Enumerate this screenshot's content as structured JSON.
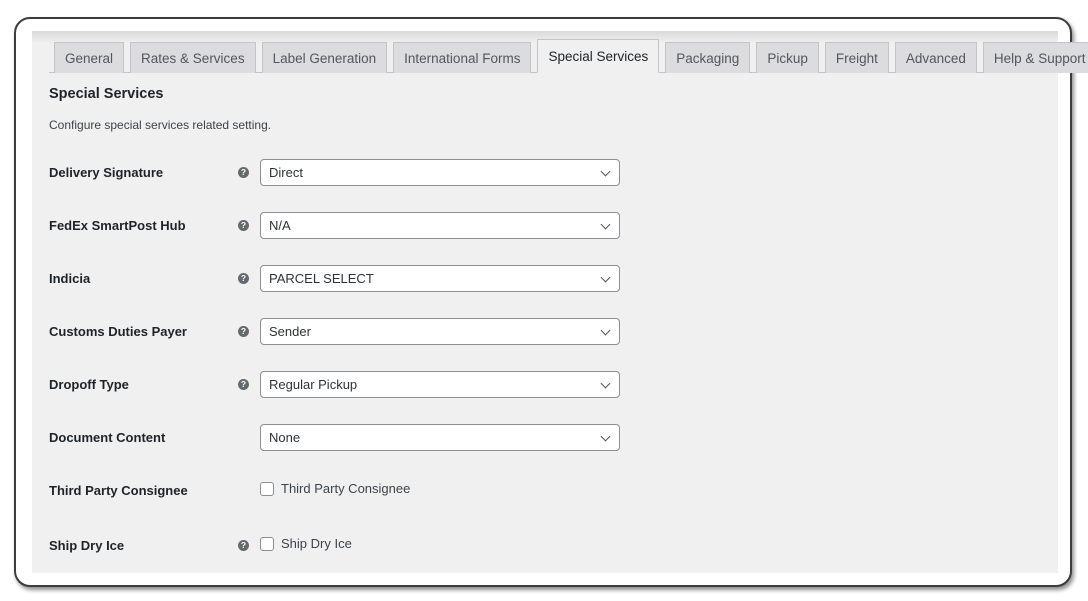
{
  "tabs": [
    {
      "label": "General",
      "active": false
    },
    {
      "label": "Rates & Services",
      "active": false
    },
    {
      "label": "Label Generation",
      "active": false
    },
    {
      "label": "International Forms",
      "active": false
    },
    {
      "label": "Special Services",
      "active": true
    },
    {
      "label": "Packaging",
      "active": false
    },
    {
      "label": "Pickup",
      "active": false
    },
    {
      "label": "Freight",
      "active": false
    },
    {
      "label": "Advanced",
      "active": false
    },
    {
      "label": "Help & Support",
      "active": false
    }
  ],
  "section": {
    "title": "Special Services",
    "description": "Configure special services related setting."
  },
  "help_icon_glyph": "?",
  "fields": {
    "delivery_signature": {
      "label": "Delivery Signature",
      "value": "Direct",
      "has_help": true
    },
    "smartpost_hub": {
      "label": "FedEx SmartPost Hub",
      "value": "N/A",
      "has_help": true
    },
    "indicia": {
      "label": "Indicia",
      "value": "PARCEL SELECT",
      "has_help": true
    },
    "customs_duties_payer": {
      "label": "Customs Duties Payer",
      "value": "Sender",
      "has_help": true
    },
    "dropoff_type": {
      "label": "Dropoff Type",
      "value": "Regular Pickup",
      "has_help": true
    },
    "document_content": {
      "label": "Document Content",
      "value": "None",
      "has_help": false
    },
    "third_party_consignee": {
      "label": "Third Party Consignee",
      "checkbox_label": "Third Party Consignee",
      "checked": false,
      "has_help": false
    },
    "ship_dry_ice": {
      "label": "Ship Dry Ice",
      "checkbox_label": "Ship Dry Ice",
      "checked": false,
      "has_help": true
    }
  }
}
